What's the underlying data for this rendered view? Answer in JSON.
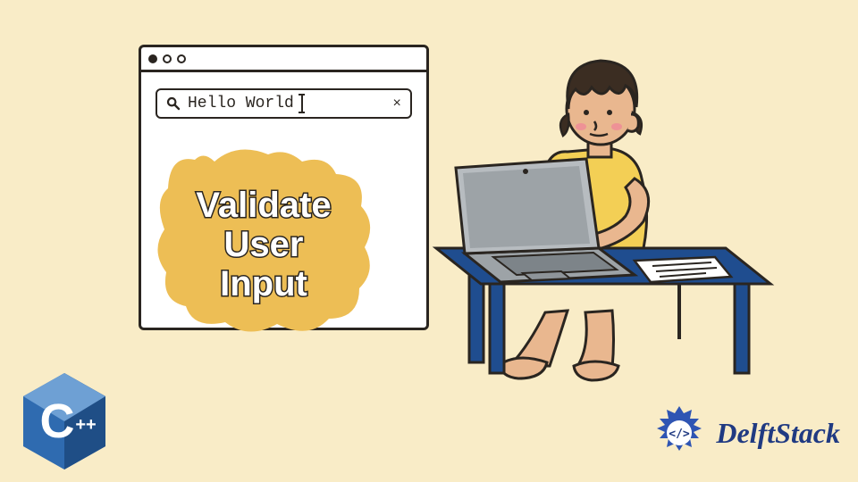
{
  "searchbar": {
    "value": "Hello World",
    "clear_glyph": "×"
  },
  "bubble": {
    "line1": "Validate",
    "line2": "User",
    "line3": "Input"
  },
  "cpp_badge": {
    "letter": "C",
    "plus": "++"
  },
  "brand": {
    "name": "DelftStack"
  },
  "colors": {
    "background": "#f9ecc7",
    "ink": "#2a2520",
    "bubble": "#edbe55",
    "cpp_blue": "#2f6bb0",
    "cpp_blue_dark": "#1f4e86",
    "delft_blue": "#203a82",
    "desk_blue": "#1f4d8f",
    "laptop_grey": "#9da3a7",
    "laptop_grey_dark": "#7d8489",
    "shirt": "#f3cf55",
    "skin": "#e9b78f",
    "hair": "#3b2d22",
    "paper": "#ffffff"
  }
}
